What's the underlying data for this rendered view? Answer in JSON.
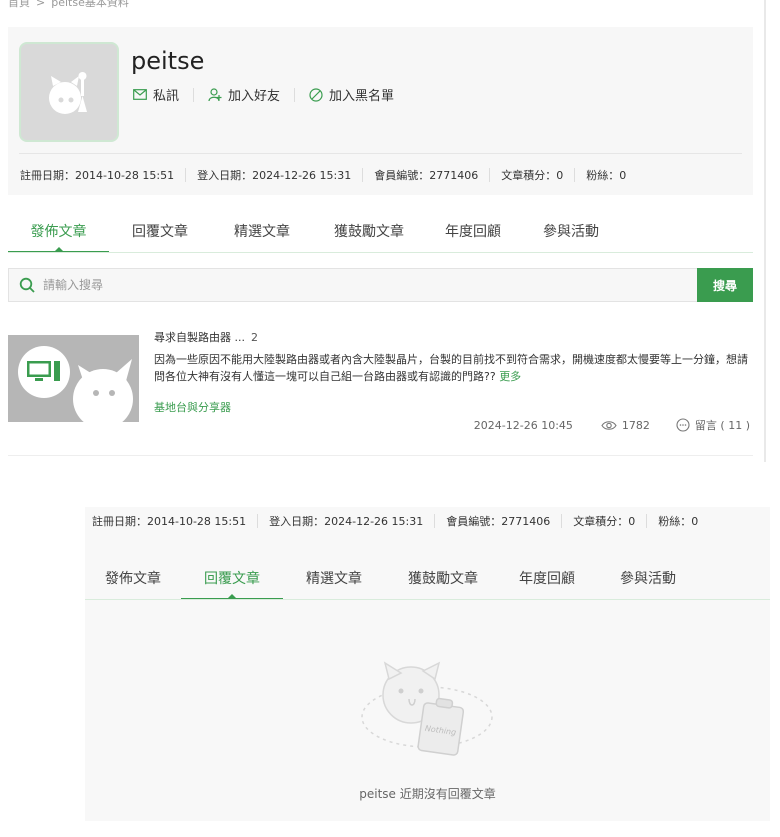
{
  "breadcrumb": {
    "home": "首頁",
    "separator": ">",
    "current": "peitse基本資料"
  },
  "profile": {
    "username": "peitse",
    "actions": {
      "message": "私訊",
      "add_friend": "加入好友",
      "block": "加入黑名單"
    },
    "stats": {
      "register": "註冊日期：2014-10-28 15:51",
      "login": "登入日期：2024-12-26 15:31",
      "member_id": "會員編號：2771406",
      "article_points": "文章積分：0",
      "fans": "粉絲：0"
    }
  },
  "tabs": [
    "發佈文章",
    "回覆文章",
    "精選文章",
    "獲鼓勵文章",
    "年度回顧",
    "參與活動"
  ],
  "search": {
    "placeholder": "請輸入搜尋",
    "button": "搜尋"
  },
  "post": {
    "title": "尋求自製路由器",
    "ellipsis": "...",
    "count": "2",
    "excerpt": "因為一些原因不能用大陸製路由器或者內含大陸製晶片，台製的目前找不到符合需求，開機速度都太慢要等上一分鐘，想請問各位大神有沒有人懂這一塊可以自己組一台路由器或有認識的門路??",
    "more": "更多",
    "board": "基地台與分享器",
    "date": "2024-12-26 10:45",
    "views": "1782",
    "comments": "留言 ( 11 )"
  },
  "empty_state": {
    "badge": "Nothing",
    "message": "peitse 近期沒有回覆文章"
  },
  "colors": {
    "accent": "#3a9c4f",
    "panel_bg": "#f7f7f7"
  }
}
